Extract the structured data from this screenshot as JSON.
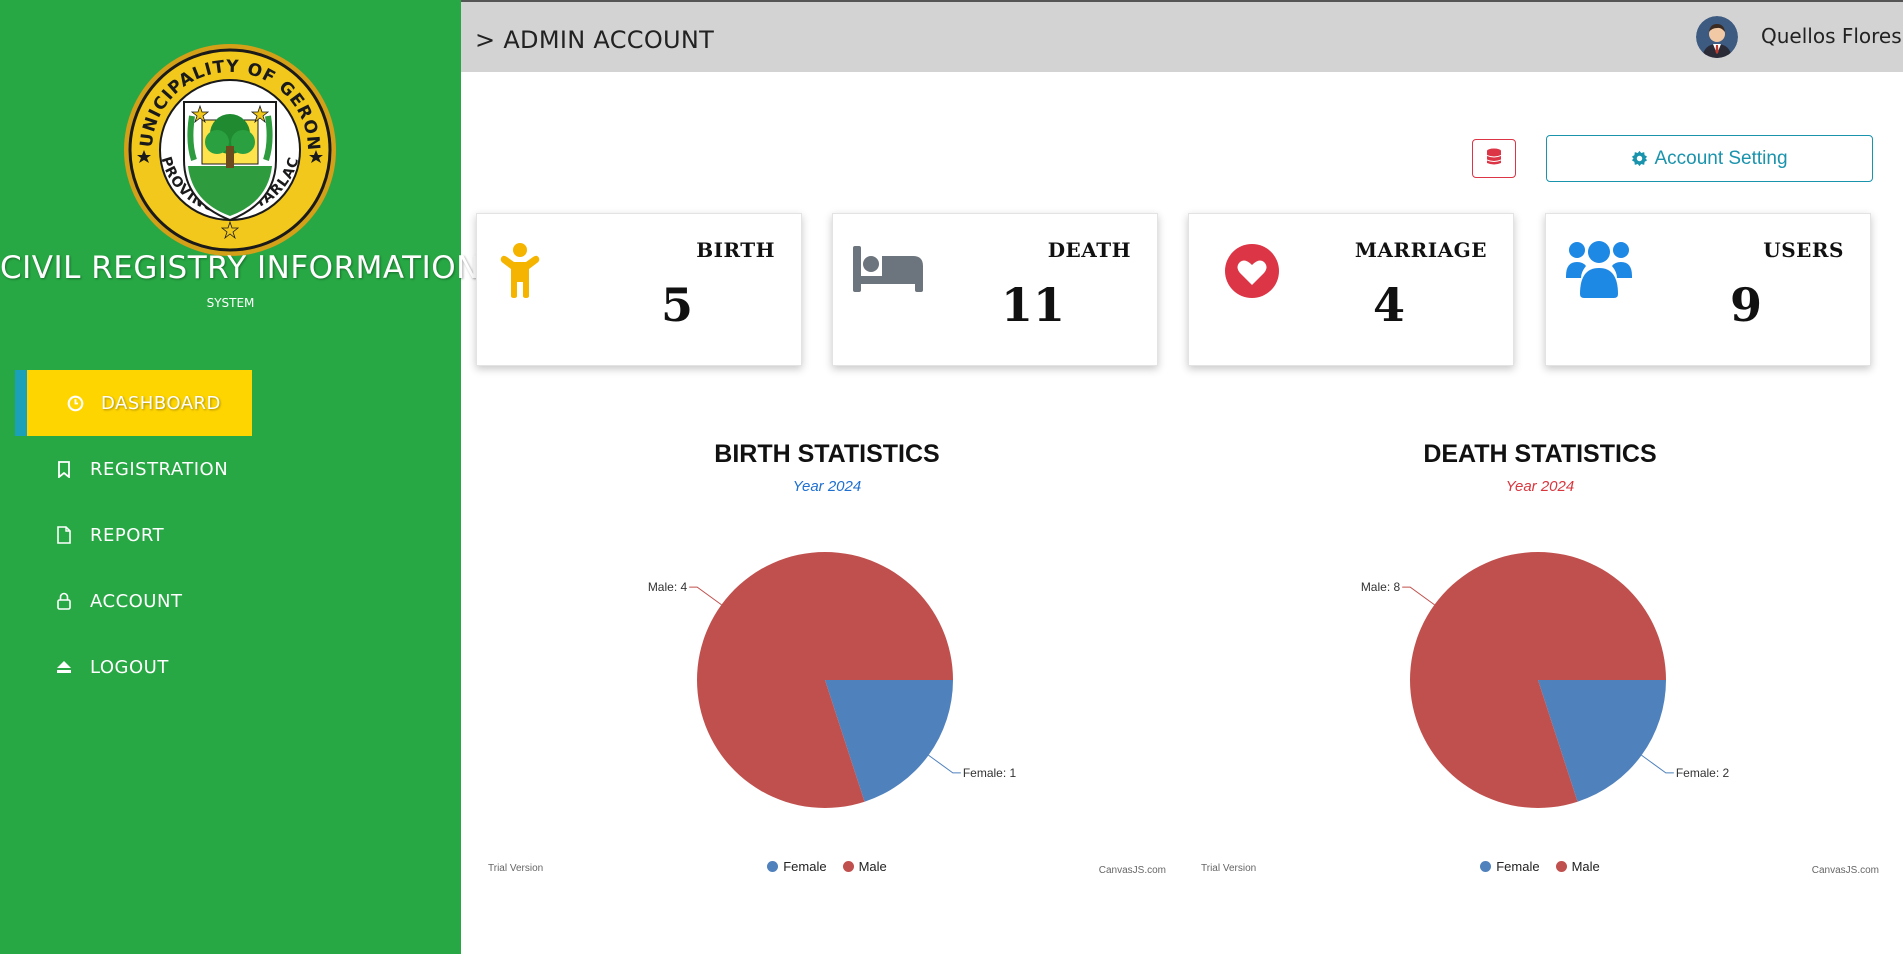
{
  "brand": {
    "title": "CIVIL REGISTRY INFORMATION",
    "subtitle": "SYSTEM",
    "seal_top_text": "MUNICIPALITY OF GERONA",
    "seal_bottom_text": "PROVINCE OF TARLAC"
  },
  "sidebar": {
    "items": [
      {
        "label": "DASHBOARD",
        "icon": "clock-icon",
        "active": true
      },
      {
        "label": "REGISTRATION",
        "icon": "bookmark-icon",
        "active": false
      },
      {
        "label": "REPORT",
        "icon": "file-icon",
        "active": false
      },
      {
        "label": "ACCOUNT",
        "icon": "lock-icon",
        "active": false
      },
      {
        "label": "LOGOUT",
        "icon": "eject-icon",
        "active": false
      }
    ]
  },
  "header": {
    "title": "> ADMIN ACCOUNT",
    "user_name": "Quellos Flores"
  },
  "toolbar": {
    "db_icon": "database-icon",
    "account_setting_label": "Account Setting"
  },
  "cards": [
    {
      "label": "BIRTH",
      "value": "5",
      "icon": "child-icon",
      "color": "#f4b400"
    },
    {
      "label": "DEATH",
      "value": "11",
      "icon": "bed-icon",
      "color": "#6c757d"
    },
    {
      "label": "MARRIAGE",
      "value": "4",
      "icon": "heart-icon",
      "color": "#dc3545"
    },
    {
      "label": "USERS",
      "value": "9",
      "icon": "users-icon",
      "color": "#1e88e5"
    }
  ],
  "colors": {
    "sidebar": "#27a844",
    "active_item": "#ffd500",
    "female": "#4f81bd",
    "male": "#c0504d",
    "birth_subtitle": "#1e6fd0",
    "death_subtitle": "#d9363e"
  },
  "chart_data": [
    {
      "type": "pie",
      "title": "BIRTH STATISTICS",
      "subtitle": "Year 2024",
      "categories": [
        "Female",
        "Male"
      ],
      "values": [
        1,
        4
      ],
      "data_labels": [
        "Female: 1",
        "Male: 4"
      ],
      "legend": {
        "position": "bottom",
        "entries": [
          "Female",
          "Male"
        ]
      },
      "watermark_left": "Trial Version",
      "watermark_right": "CanvasJS.com"
    },
    {
      "type": "pie",
      "title": "DEATH STATISTICS",
      "subtitle": "Year 2024",
      "categories": [
        "Female",
        "Male"
      ],
      "values": [
        2,
        8
      ],
      "data_labels": [
        "Female: 2",
        "Male: 8"
      ],
      "legend": {
        "position": "bottom",
        "entries": [
          "Female",
          "Male"
        ]
      },
      "watermark_left": "Trial Version",
      "watermark_right": "CanvasJS.com"
    }
  ]
}
